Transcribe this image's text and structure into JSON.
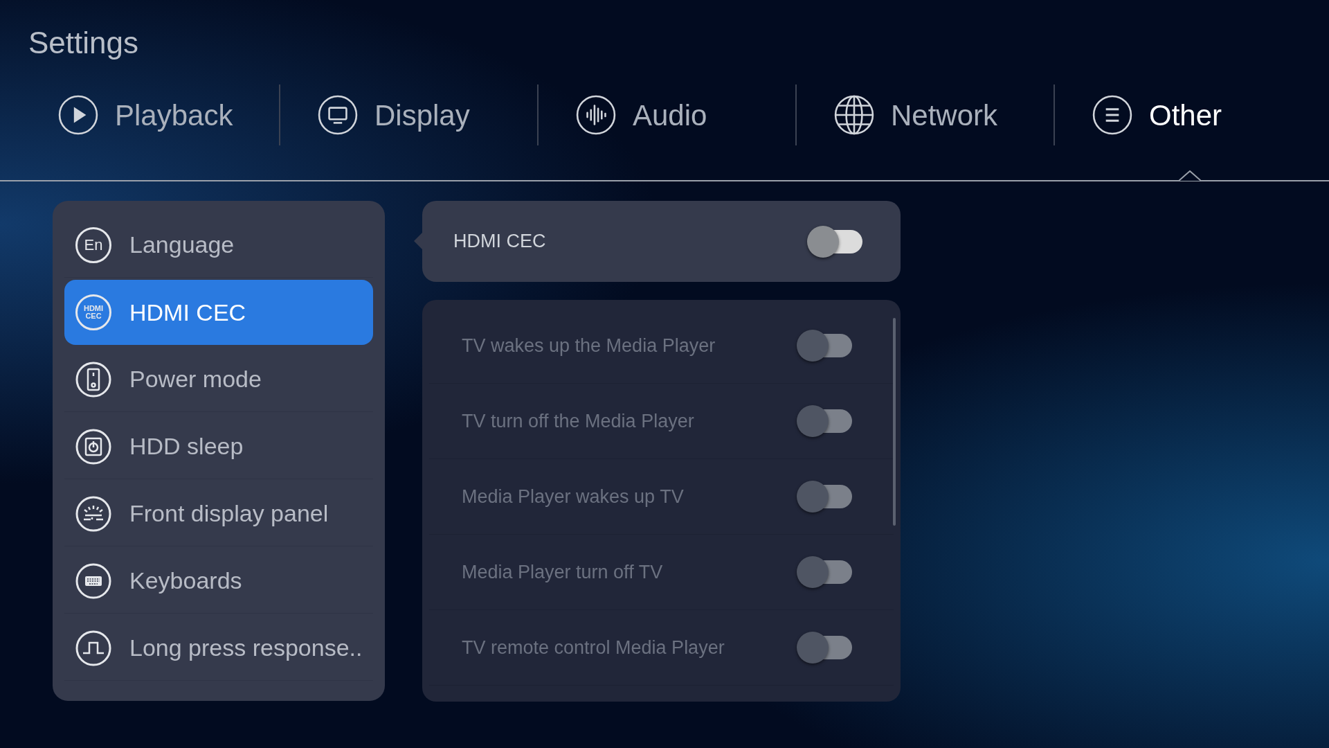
{
  "title": "Settings",
  "tabs": [
    {
      "label": "Playback",
      "kind": "play",
      "selected": false
    },
    {
      "label": "Display",
      "kind": "monitor",
      "selected": false
    },
    {
      "label": "Audio",
      "kind": "audio",
      "selected": false
    },
    {
      "label": "Network",
      "kind": "globe",
      "selected": false
    },
    {
      "label": "Other",
      "kind": "list",
      "selected": true
    }
  ],
  "menu": [
    {
      "label": "Language",
      "kind": "text",
      "icon_text": [
        "En"
      ],
      "selected": false
    },
    {
      "label": "HDMI CEC",
      "kind": "text",
      "icon_text": [
        "HDMI",
        "CEC"
      ],
      "selected": true
    },
    {
      "label": "Power mode",
      "kind": "device",
      "selected": false
    },
    {
      "label": "HDD sleep",
      "kind": "disk",
      "selected": false
    },
    {
      "label": "Front display panel",
      "kind": "panel",
      "selected": false
    },
    {
      "label": "Keyboards",
      "kind": "keyboard",
      "selected": false
    },
    {
      "label": "Long press response..",
      "kind": "pulse",
      "selected": false
    }
  ],
  "master": {
    "label": "HDMI CEC",
    "on": false
  },
  "options": [
    {
      "label": "TV wakes up the Media Player",
      "on": false,
      "disabled": true
    },
    {
      "label": "TV turn off the Media Player",
      "on": false,
      "disabled": true
    },
    {
      "label": "Media Player wakes up TV",
      "on": false,
      "disabled": true
    },
    {
      "label": "Media Player turn off TV",
      "on": false,
      "disabled": true
    },
    {
      "label": "TV remote control Media Player",
      "on": false,
      "disabled": true
    }
  ]
}
